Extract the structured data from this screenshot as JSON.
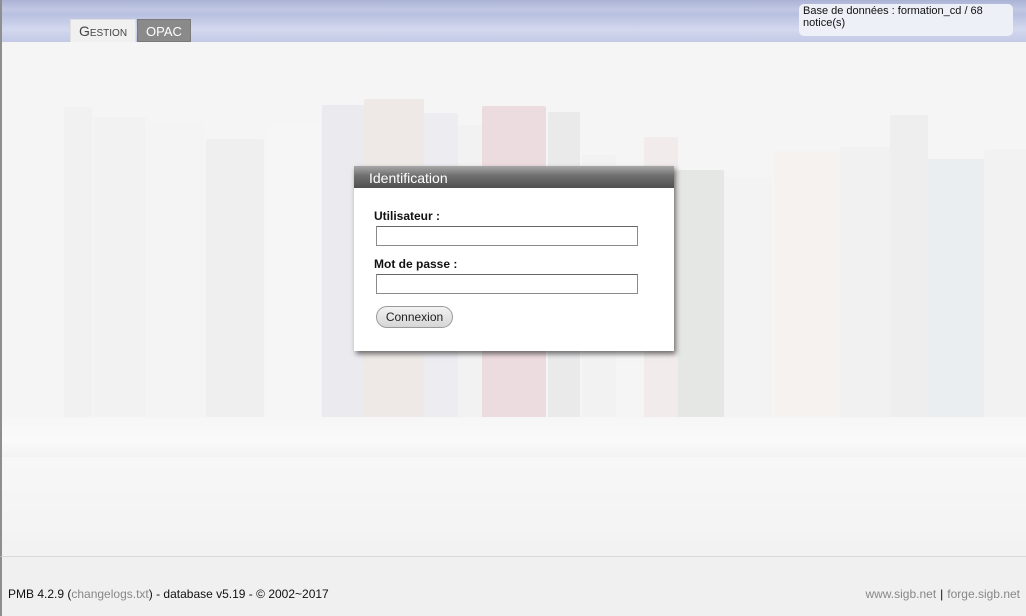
{
  "header": {
    "tabs": [
      {
        "label": "Gestion",
        "active": true
      },
      {
        "label": "OPAC",
        "active": false
      }
    ],
    "db_info": "Base de données : formation_cd / 68 notice(s)"
  },
  "login": {
    "title": "Identification",
    "user_label": "Utilisateur :",
    "user_value": "",
    "password_label": "Mot de passe :",
    "password_value": "",
    "submit_label": "Connexion"
  },
  "footer": {
    "version_prefix": "PMB 4.2.9 (",
    "changelog_link": "changelogs.txt",
    "version_suffix": ") - database v5.19 - © 2002~2017",
    "links": [
      "www.sigb.net",
      "forge.sigb.net"
    ],
    "separator": "|"
  },
  "colors": {
    "accent": "#8a8a8a",
    "dialog_title_bg": "#5a5a5a",
    "header_bg": "#c3cae6"
  }
}
